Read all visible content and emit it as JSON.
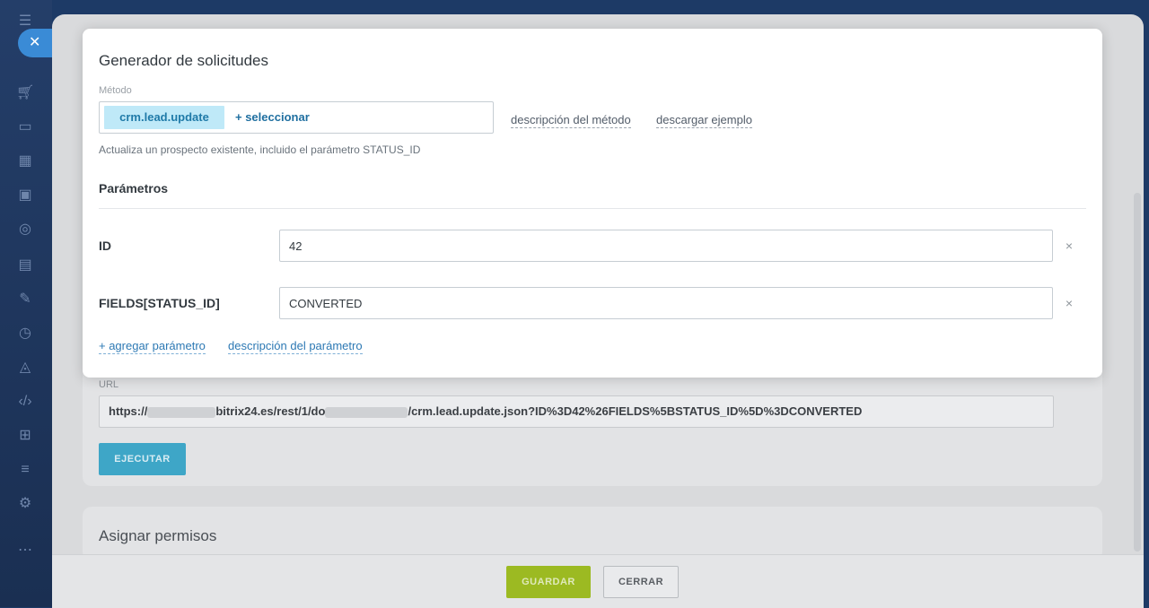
{
  "sidebar": {
    "close_label": "✕",
    "icons": [
      "menu-icon",
      "cart-icon",
      "chat-icon",
      "calendar-icon",
      "box-icon",
      "target-icon",
      "document-icon",
      "pencil-icon",
      "clock-icon",
      "chart-icon",
      "code-icon",
      "grid-icon",
      "list-icon",
      "settings-icon",
      "dots-icon"
    ]
  },
  "modal": {
    "title": "Generador de solicitudes",
    "method_label": "Método",
    "method_value": "crm.lead.update",
    "select_label": "+  seleccionar",
    "method_description_link": "descripción del método",
    "download_example_link": "descargar ejemplo",
    "description": "Actualiza un prospecto existente, incluido el parámetro STATUS_ID",
    "params_title": "Parámetros",
    "params": [
      {
        "name": "ID",
        "value": "42"
      },
      {
        "name": "FIELDS[STATUS_ID]",
        "value": "CONVERTED"
      }
    ],
    "remove_label": "×",
    "add_param_link": "+ agregar parámetro",
    "param_description_link": "descripción del parámetro"
  },
  "background": {
    "url_label": "URL",
    "url_part1": "https://",
    "url_part2": "bitrix24.es/rest/1/do",
    "url_part3": "/crm.lead.update.json?ID%3D42%26FIELDS%5BSTATUS_ID%5D%3DCONVERTED",
    "execute_button": "EJECUTAR",
    "permissions_title": "Asignar permisos"
  },
  "footer": {
    "save_button": "GUARDAR",
    "close_button": "CERRAR"
  },
  "colors": {
    "accent": "#2d79b4",
    "method_tag": "#bfe9f8",
    "save": "#9cba22",
    "execute": "#3ea6c7"
  }
}
